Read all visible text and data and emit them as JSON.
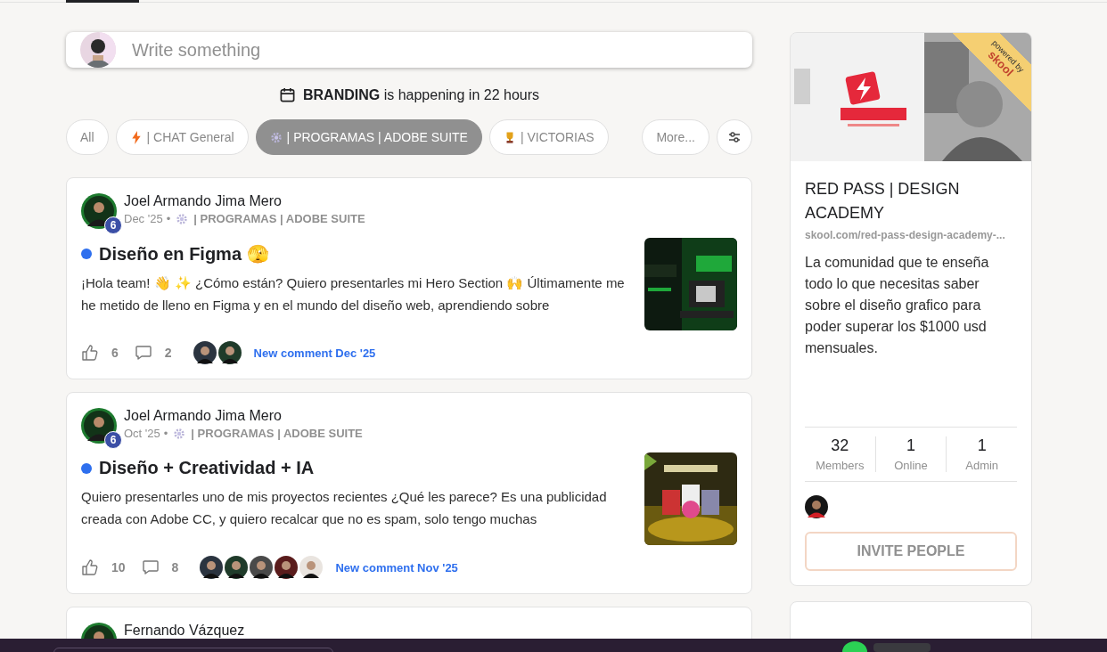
{
  "composer": {
    "placeholder": "Write something"
  },
  "event": {
    "text": "**BRANDING** is happening in 22 hours"
  },
  "filters": [
    {
      "label": "All",
      "selected": false
    },
    {
      "label": "| CHAT General",
      "selected": false
    },
    {
      "label": "| PROGRAMAS | ADOBE SUITE",
      "selected": true
    },
    {
      "label": "| VICTORIAS",
      "selected": false
    }
  ],
  "more_button": "More...",
  "posts": [
    {
      "author": "Joel Armando Jima Mero",
      "level_badge": "6",
      "date": "Dec '25",
      "bullet": "•",
      "category": "| PROGRAMAS | ADOBE SUITE",
      "unread": true,
      "title": "Diseño en Figma 🫣",
      "body": "¡Hola team! 👋 ✨ ¿Cómo están? Quiero presentarles mi Hero Section 🙌 Últimamente me he metido de lleno en Figma y en el mundo del diseño web, aprendiendo sobre",
      "likes": "6",
      "comments": "2",
      "last_activity": "New comment Dec '25"
    },
    {
      "author": "Joel Armando Jima Mero",
      "level_badge": "6",
      "date": "Oct '25",
      "bullet": "•",
      "category": "| PROGRAMAS | ADOBE SUITE",
      "unread": true,
      "title": "Diseño + Creatividad + IA",
      "body": "Quiero presentarles uno de mis proyectos recientes ¿Qué les parece? Es una publicidad creada con Adobe CC, y quiero recalcar que no es spam, solo tengo muchas",
      "likes": "10",
      "comments": "8",
      "last_activity": "New comment Nov '25"
    },
    {
      "author": "Fernando Vázquez"
    }
  ],
  "community": {
    "ribbon_line_1": "powered by",
    "ribbon_line_2": "skool",
    "name": "RED PASS | DESIGN ACADEMY",
    "url": "skool.com/red-pass-design-academy-...",
    "description": "La comunidad que te enseña todo lo que necesitas saber sobre el diseño grafico para poder superar los $1000 usd mensuales.",
    "stats": [
      {
        "value": "32",
        "label": "Members"
      },
      {
        "value": "1",
        "label": "Online"
      },
      {
        "value": "1",
        "label": "Admin"
      }
    ],
    "invite_button": "INVITE PEOPLE"
  }
}
